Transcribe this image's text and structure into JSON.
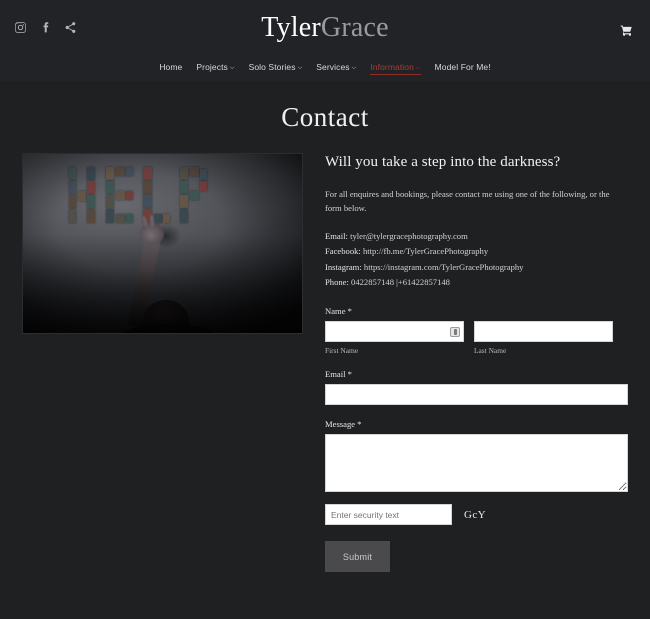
{
  "header": {
    "logo_primary": "Tyler",
    "logo_secondary": "Grace",
    "social": [
      {
        "name": "instagram-icon",
        "label": "Instagram"
      },
      {
        "name": "facebook-icon",
        "label": "Facebook"
      },
      {
        "name": "share-icon",
        "label": "Share"
      }
    ],
    "cart_label": "Cart"
  },
  "nav": {
    "items": [
      {
        "label": "Home",
        "has_caret": false,
        "active": false
      },
      {
        "label": "Projects",
        "has_caret": true,
        "active": false
      },
      {
        "label": "Solo Stories",
        "has_caret": true,
        "active": false
      },
      {
        "label": "Services",
        "has_caret": true,
        "active": false
      },
      {
        "label": "Information",
        "has_caret": true,
        "active": true
      },
      {
        "label": "Model For Me!",
        "has_caret": false,
        "active": false
      }
    ],
    "caret_glyph": "⌵",
    "active_color": "#b03a32"
  },
  "page_title": "Contact",
  "photo": {
    "alt": "Person reaching up toward the word HELP spelled out in photographs on a dark wall",
    "word": "HELP"
  },
  "main": {
    "headline": "Will you take a step into the darkness?",
    "intro": "For all enquires and bookings, please contact me using one of the following, or the form below.",
    "contacts": [
      {
        "key": "Email:",
        "value": "tyler@tylergracephotography.com"
      },
      {
        "key": "Facebook:",
        "value": "http://fb.me/TylerGracePhotography"
      },
      {
        "key": "Instagram:",
        "value": "https://instagram.com/TylerGracePhotography"
      },
      {
        "key": "Phone:",
        "value": "0422857148  |+61422857148"
      }
    ]
  },
  "form": {
    "name_label": "Name *",
    "first_name_value": "",
    "first_name_placeholder": "",
    "first_name_sublabel": "First Name",
    "last_name_value": "",
    "last_name_placeholder": "",
    "last_name_sublabel": "Last Name",
    "autofill_icon_name": "contact-card-autofill-icon",
    "email_label": "Email *",
    "email_value": "",
    "email_placeholder": "",
    "message_label": "Message *",
    "message_value": "",
    "message_placeholder": "",
    "captcha_placeholder": "Enter security text",
    "captcha_value": "",
    "captcha_text": "GcY",
    "submit_label": "Submit"
  },
  "colors": {
    "background": "#1f2022",
    "header_background": "#212326",
    "accent_red": "#b03a32",
    "text_primary": "#f0f0f0",
    "text_secondary": "#d2d2d2",
    "input_background": "#ffffff",
    "submit_background": "#4a4a4c"
  }
}
